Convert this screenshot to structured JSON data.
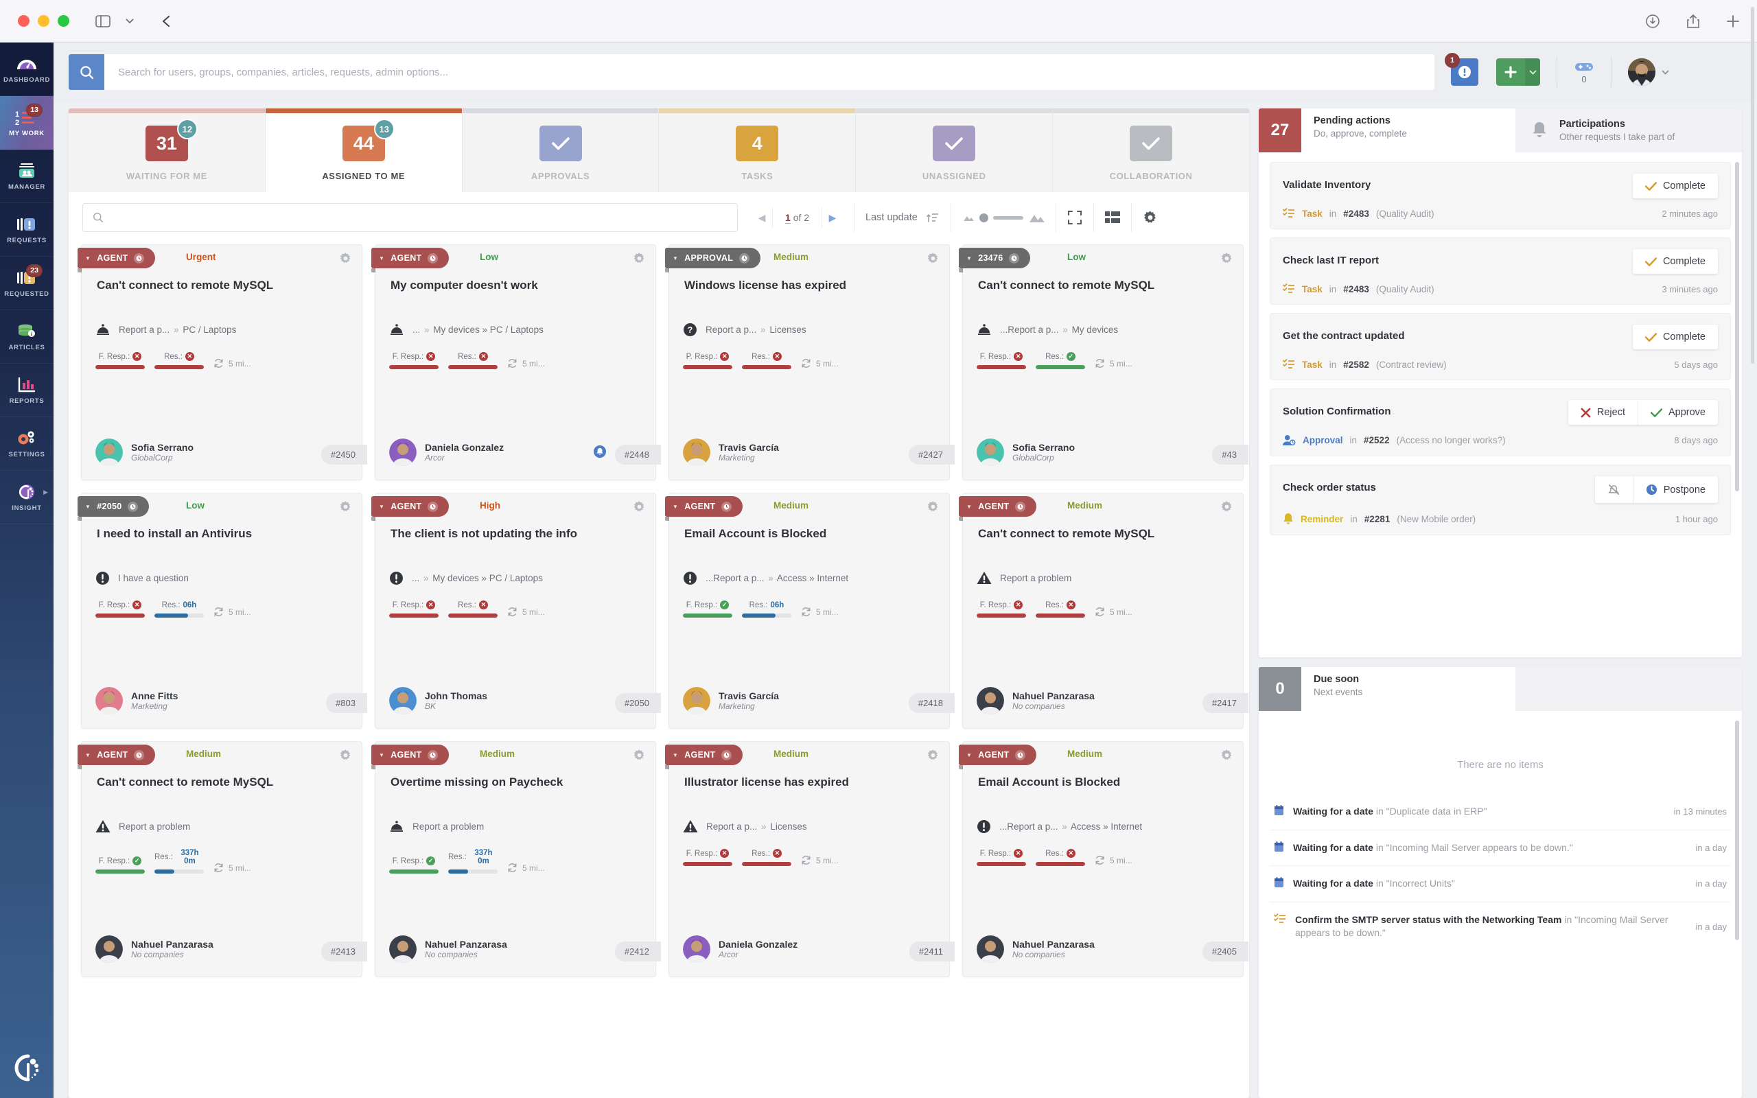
{
  "window": {
    "traffic": [
      "close",
      "minimize",
      "zoom"
    ],
    "toolbar_icons": [
      "sidebar-toggle-icon",
      "chevron-down-icon",
      "back-arrow-icon"
    ],
    "right_icons": [
      "download-icon",
      "share-icon",
      "new-tab-icon"
    ]
  },
  "sidebar": {
    "items": [
      {
        "label": "DASHBOARD",
        "icon": "gauge-icon",
        "badge": null,
        "active": false
      },
      {
        "label": "MY WORK",
        "icon": "numbered-list-icon",
        "badge": "13",
        "active": true
      },
      {
        "label": "MANAGER",
        "icon": "group-box-icon",
        "badge": null,
        "active": false
      },
      {
        "label": "REQUESTS",
        "icon": "tickets-blue-icon",
        "badge": null,
        "active": false
      },
      {
        "label": "REQUESTED",
        "icon": "tickets-amber-icon",
        "badge": "23",
        "active": false
      },
      {
        "label": "ARTICLES",
        "icon": "database-info-icon",
        "badge": null,
        "active": false
      },
      {
        "label": "REPORTS",
        "icon": "bar-chart-icon",
        "badge": null,
        "active": false
      },
      {
        "label": "SETTINGS",
        "icon": "gears-icon",
        "badge": null,
        "active": false
      },
      {
        "label": "INSIGHT",
        "icon": "insight-logo-icon",
        "badge": null,
        "active": false,
        "expandable": true
      }
    ]
  },
  "topbar": {
    "search_placeholder": "Search for users, groups, companies, articles, requests, admin options...",
    "search_value": "",
    "alert_badge": "1",
    "game_count": "0"
  },
  "tabs": [
    {
      "label": "WAITING FOR ME",
      "count": "31",
      "badge": "12",
      "color": "#b0504f",
      "accent": "#e3bdbc",
      "active": false
    },
    {
      "label": "ASSIGNED TO ME",
      "count": "44",
      "badge": "13",
      "color": "#d87a51",
      "accent": "#c4663c",
      "active": true
    },
    {
      "label": "APPROVALS",
      "count": "check",
      "badge": null,
      "color": "#98a4cd",
      "accent": "#d6d8de",
      "active": false
    },
    {
      "label": "TASKS",
      "count": "4",
      "badge": null,
      "color": "#d9a33e",
      "accent": "#e8d5ac",
      "active": false
    },
    {
      "label": "UNASSIGNED",
      "count": "check",
      "badge": null,
      "color": "#a79dc4",
      "accent": "#dcdce1",
      "active": false
    },
    {
      "label": "COLLABORATION",
      "count": "check",
      "badge": null,
      "color": "#b9bcc1",
      "accent": "#dcdce1",
      "active": false
    }
  ],
  "board_toolbar": {
    "filter_placeholder": "",
    "filter_value": "",
    "page_current": "1",
    "page_of": "of 2",
    "sort_label": "Last update",
    "icons": [
      "sort-icon",
      "zoom-slider",
      "fullscreen-icon",
      "list-view-icon",
      "settings-gear-icon"
    ]
  },
  "cards": [
    {
      "ribbon_label": "AGENT",
      "ribbon_color": "#a8504f",
      "priority": "Urgent",
      "priority_color": "#c8561f",
      "title": "Can't connect to remote MySQL",
      "cat_icon": "service-bell-icon",
      "cat_text": "Report a p...",
      "cat_sep": "»",
      "cat_tail": "PC / Laptops",
      "fresp_label": "F. Resp.:",
      "fresp_state": "fail",
      "fresp_fill": 100,
      "fresp_color": "#b03f3f",
      "res_label": "Res.:",
      "res_state": "fail",
      "res_value": "",
      "res_fill": 100,
      "res_color": "#b03f3f",
      "refresh_text": "5 mi...",
      "user": "Sofia Serrano",
      "company": "GlobalCorp",
      "avatar_color": "#49c2ae",
      "ticket": "#2450",
      "notif": null
    },
    {
      "ribbon_label": "AGENT",
      "ribbon_color": "#a8504f",
      "priority": "Low",
      "priority_color": "#3f9c4f",
      "title": "My computer doesn't work",
      "cat_icon": "service-bell-icon",
      "cat_text": "...",
      "cat_sep": "»",
      "cat_tail": "My devices » PC / Laptops",
      "fresp_label": "F. Resp.:",
      "fresp_state": "fail",
      "fresp_fill": 100,
      "fresp_color": "#b03f3f",
      "res_label": "Res.:",
      "res_state": "fail",
      "res_value": "",
      "res_fill": 100,
      "res_color": "#b03f3f",
      "refresh_text": "5 mi...",
      "user": "Daniela Gonzalez",
      "company": "Arcor",
      "avatar_color": "#8a5fc0",
      "ticket": "#2448",
      "notif": "bell"
    },
    {
      "ribbon_label": "APPROVAL",
      "ribbon_color": "#6a6a6a",
      "priority": "Medium",
      "priority_color": "#8a9a34",
      "title": "Windows license has expired",
      "cat_icon": "question-circle-icon",
      "cat_text": "Report a p...",
      "cat_sep": "»",
      "cat_tail": "Licenses",
      "fresp_label": "P. Resp.:",
      "fresp_state": "fail",
      "fresp_fill": 100,
      "fresp_color": "#b03f3f",
      "res_label": "Res.:",
      "res_state": "fail",
      "res_value": "",
      "res_fill": 100,
      "res_color": "#b03f3f",
      "refresh_text": "5 mi...",
      "user": "Travis García",
      "company": "Marketing",
      "avatar_color": "#d8a33e",
      "ticket": "#2427",
      "notif": null
    },
    {
      "ribbon_label": "23476",
      "ribbon_color": "#6a6a6a",
      "priority": "Low",
      "priority_color": "#3f9c4f",
      "title": "Can't connect to remote MySQL",
      "cat_icon": "service-bell-icon",
      "cat_text": "...Report a p...",
      "cat_sep": "»",
      "cat_tail": "My devices",
      "fresp_label": "F. Resp.:",
      "fresp_state": "fail",
      "fresp_fill": 100,
      "fresp_color": "#b03f3f",
      "res_label": "Res.:",
      "res_state": "ok",
      "res_value": "",
      "res_fill": 100,
      "res_color": "#49a05a",
      "refresh_text": "5 mi...",
      "user": "Sofia Serrano",
      "company": "GlobalCorp",
      "avatar_color": "#49c2ae",
      "ticket": "#43",
      "notif": null
    },
    {
      "ribbon_label": "#2050",
      "ribbon_color": "#6a6a6a",
      "priority": "Low",
      "priority_color": "#3f9c4f",
      "title": "I need to install an Antivirus",
      "cat_icon": "exclamation-circle-icon",
      "cat_text": "I have a question",
      "cat_sep": "",
      "cat_tail": "",
      "fresp_label": "F. Resp.:",
      "fresp_state": "fail",
      "fresp_fill": 100,
      "fresp_color": "#b03f3f",
      "res_label": "Res.:",
      "res_state": "value",
      "res_value": "06h",
      "res_fill": 68,
      "res_color": "#2b6ca3",
      "refresh_text": "5 mi...",
      "user": "Anne Fitts",
      "company": "Marketing",
      "avatar_color": "#e07c8c",
      "ticket": "#803",
      "notif": null
    },
    {
      "ribbon_label": "AGENT",
      "ribbon_color": "#a8504f",
      "priority": "High",
      "priority_color": "#c8561f",
      "title": "The client is not updating the info",
      "cat_icon": "exclamation-circle-icon",
      "cat_text": "...",
      "cat_sep": "»",
      "cat_tail": "My devices » PC / Laptops",
      "fresp_label": "F. Resp.:",
      "fresp_state": "fail",
      "fresp_fill": 100,
      "fresp_color": "#b03f3f",
      "res_label": "Res.:",
      "res_state": "fail",
      "res_value": "",
      "res_fill": 100,
      "res_color": "#b03f3f",
      "refresh_text": "5 mi...",
      "user": "John Thomas",
      "company": "BK",
      "avatar_color": "#4b8fd0",
      "ticket": "#2050",
      "notif": null
    },
    {
      "ribbon_label": "AGENT",
      "ribbon_color": "#a8504f",
      "priority": "Medium",
      "priority_color": "#8a9a34",
      "title": "Email Account is Blocked",
      "cat_icon": "exclamation-circle-icon",
      "cat_text": "...Report a p...",
      "cat_sep": "»",
      "cat_tail": "Access » Internet",
      "fresp_label": "F. Resp.:",
      "fresp_state": "ok",
      "fresp_fill": 100,
      "fresp_color": "#49a05a",
      "res_label": "Res.:",
      "res_state": "value",
      "res_value": "06h",
      "res_fill": 68,
      "res_color": "#2b6ca3",
      "refresh_text": "5 mi...",
      "user": "Travis García",
      "company": "Marketing",
      "avatar_color": "#d8a33e",
      "ticket": "#2418",
      "notif": null
    },
    {
      "ribbon_label": "AGENT",
      "ribbon_color": "#a8504f",
      "priority": "Medium",
      "priority_color": "#8a9a34",
      "title": "Can't connect to remote MySQL",
      "cat_icon": "warning-triangle-icon",
      "cat_text": "Report a problem",
      "cat_sep": "",
      "cat_tail": "",
      "fresp_label": "F. Resp.:",
      "fresp_state": "fail",
      "fresp_fill": 100,
      "fresp_color": "#b03f3f",
      "res_label": "Res.:",
      "res_state": "fail",
      "res_value": "",
      "res_fill": 100,
      "res_color": "#b03f3f",
      "refresh_text": "5 mi...",
      "user": "Nahuel Panzarasa",
      "company": "No companies",
      "avatar_color": "#3a3f4a",
      "ticket": "#2417",
      "notif": null
    },
    {
      "ribbon_label": "AGENT",
      "ribbon_color": "#a8504f",
      "priority": "Medium",
      "priority_color": "#8a9a34",
      "title": "Can't connect to remote MySQL",
      "cat_icon": "warning-triangle-icon",
      "cat_text": "Report a problem",
      "cat_sep": "",
      "cat_tail": "",
      "fresp_label": "F. Resp.:",
      "fresp_state": "ok",
      "fresp_fill": 100,
      "fresp_color": "#49a05a",
      "res_label": "Res.:",
      "res_state": "value",
      "res_value": "337h 0m",
      "res_fill": 40,
      "res_color": "#2b6ca3",
      "refresh_text": "5 mi...",
      "user": "Nahuel Panzarasa",
      "company": "No companies",
      "avatar_color": "#3a3f4a",
      "ticket": "#2413",
      "notif": null
    },
    {
      "ribbon_label": "AGENT",
      "ribbon_color": "#a8504f",
      "priority": "Medium",
      "priority_color": "#8a9a34",
      "title": "Overtime missing on Paycheck",
      "cat_icon": "service-bell-icon",
      "cat_text": "Report a problem",
      "cat_sep": "",
      "cat_tail": "",
      "fresp_label": "F. Resp.:",
      "fresp_state": "ok",
      "fresp_fill": 100,
      "fresp_color": "#49a05a",
      "res_label": "Res.:",
      "res_state": "value",
      "res_value": "337h 0m",
      "res_fill": 40,
      "res_color": "#2b6ca3",
      "refresh_text": "5 mi...",
      "user": "Nahuel Panzarasa",
      "company": "No companies",
      "avatar_color": "#3a3f4a",
      "ticket": "#2412",
      "notif": null
    },
    {
      "ribbon_label": "AGENT",
      "ribbon_color": "#a8504f",
      "priority": "Medium",
      "priority_color": "#8a9a34",
      "title": "Illustrator license has expired",
      "cat_icon": "warning-triangle-icon",
      "cat_text": "Report a p...",
      "cat_sep": "»",
      "cat_tail": "Licenses",
      "fresp_label": "F. Resp.:",
      "fresp_state": "fail",
      "fresp_fill": 100,
      "fresp_color": "#b03f3f",
      "res_label": "Res.:",
      "res_state": "fail",
      "res_value": "",
      "res_fill": 100,
      "res_color": "#b03f3f",
      "refresh_text": "5 mi...",
      "user": "Daniela Gonzalez",
      "company": "Arcor",
      "avatar_color": "#8a5fc0",
      "ticket": "#2411",
      "notif": null
    },
    {
      "ribbon_label": "AGENT",
      "ribbon_color": "#a8504f",
      "priority": "Medium",
      "priority_color": "#8a9a34",
      "title": "Email Account is Blocked",
      "cat_icon": "exclamation-circle-icon",
      "cat_text": "...Report a p...",
      "cat_sep": "»",
      "cat_tail": "Access » Internet",
      "fresp_label": "F. Resp.:",
      "fresp_state": "fail",
      "fresp_fill": 100,
      "fresp_color": "#b03f3f",
      "res_label": "Res.:",
      "res_state": "fail",
      "res_value": "",
      "res_fill": 100,
      "res_color": "#b03f3f",
      "refresh_text": "5 mi...",
      "user": "Nahuel Panzarasa",
      "company": "No companies",
      "avatar_color": "#3a3f4a",
      "ticket": "#2405",
      "notif": null
    }
  ],
  "pending": {
    "count": "27",
    "title": "Pending actions",
    "subtitle": "Do, approve, complete",
    "alt_title": "Participations",
    "alt_subtitle": "Other requests I take part of",
    "alt_icon": "bell-icon",
    "items": [
      {
        "title": "Validate Inventory",
        "kind": "Task",
        "kind_color": "#d79a28",
        "icon": "task-list-icon",
        "in_label": "in",
        "number": "#2483",
        "context": "(Quality Audit)",
        "ago": "2 minutes ago",
        "buttons": [
          {
            "label": "Complete",
            "icon": "check-icon",
            "color": "#d79a28"
          }
        ]
      },
      {
        "title": "Check last IT report",
        "kind": "Task",
        "kind_color": "#d79a28",
        "icon": "task-list-icon",
        "in_label": "in",
        "number": "#2483",
        "context": "(Quality Audit)",
        "ago": "3 minutes ago",
        "buttons": [
          {
            "label": "Complete",
            "icon": "check-icon",
            "color": "#d79a28"
          }
        ]
      },
      {
        "title": "Get the contract updated",
        "kind": "Task",
        "kind_color": "#d79a28",
        "icon": "task-list-icon",
        "in_label": "in",
        "number": "#2582",
        "context": "(Contract review)",
        "ago": "5 days ago",
        "buttons": [
          {
            "label": "Complete",
            "icon": "check-icon",
            "color": "#d79a28"
          }
        ]
      },
      {
        "title": "Solution Confirmation",
        "kind": "Approval",
        "kind_color": "#4a7bc4",
        "icon": "approval-user-icon",
        "in_label": "in",
        "number": "#2522",
        "context": "(Access no longer works?)",
        "ago": "8 days ago",
        "buttons": [
          {
            "label": "Reject",
            "icon": "x-icon",
            "color": "#b03f3f"
          },
          {
            "label": "Approve",
            "icon": "check-icon",
            "color": "#3f9c4f"
          }
        ]
      },
      {
        "title": "Check order status",
        "kind": "Reminder",
        "kind_color": "#d7b728",
        "icon": "reminder-bell-icon",
        "in_label": "in",
        "number": "#2281",
        "context": "(New Mobile order)",
        "ago": "1 hour ago",
        "buttons": [
          {
            "label": "",
            "icon": "bell-off-icon",
            "color": "#9a9ea6"
          },
          {
            "label": "Postpone",
            "icon": "clock-icon",
            "color": "#4a7bc4"
          }
        ]
      }
    ]
  },
  "due_soon": {
    "count": "0",
    "title": "Due soon",
    "subtitle": "Next events",
    "empty_text": "There are no items",
    "events": [
      {
        "icon": "calendar-icon",
        "bold": "Waiting for a date",
        "rest": "in \"Duplicate data in ERP\"",
        "when": "in 13 minutes"
      },
      {
        "icon": "calendar-icon",
        "bold": "Waiting for a date",
        "rest": "in \"Incoming Mail Server appears to be down.\"",
        "when": "in a day"
      },
      {
        "icon": "calendar-icon",
        "bold": "Waiting for a date",
        "rest": "in \"Incorrect Units\"",
        "when": "in a day"
      },
      {
        "icon": "task-list-icon",
        "bold": "Confirm the SMTP server status with the Networking Team",
        "rest": "in \"Incoming Mail Server appears to be down.\"",
        "when": "in a day"
      }
    ]
  }
}
